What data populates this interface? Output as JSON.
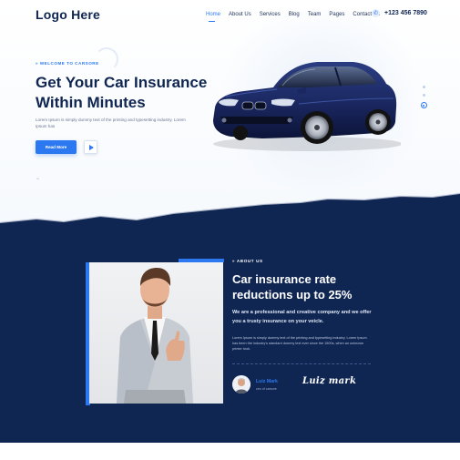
{
  "header": {
    "logo": "Logo Here",
    "nav": [
      "Home",
      "About Us",
      "Services",
      "Blog",
      "Team",
      "Pages",
      "Contact Us"
    ],
    "active_nav": "Home",
    "phone": "+123 456 7890",
    "phone_icon": "phone-icon"
  },
  "hero": {
    "eyebrow": "WELCOME TO CARSORE",
    "title": "Get Your Car Insurance Within Minutes",
    "description": "Lorem Ipsum is simply dummy text of the printing and typesetting industry. Lorem Ipsum has",
    "read_more": "Read More",
    "play_icon": "play-icon",
    "scroll_icon": "chevron-down-icon",
    "slider_dots": 3,
    "active_dot": 3
  },
  "about": {
    "tag": "ABOUT US",
    "title": "Car insurance rate reductions up to 25%",
    "lead": "We are a professional and creative company and we offer you a trusty insurance on your veicle.",
    "description": "Lorem Ipsum is simply dummy text of the printing and typesetting industry. Lorem Ipsum has been the industry's standard dummy text ever since the 1500s, when an unknown printer took.",
    "author_name": "Luiz Mark",
    "author_role": "ceo of carsore",
    "signature": "Luiz mark"
  },
  "colors": {
    "accent": "#2b78f0",
    "navy": "#0f2552",
    "white": "#ffffff"
  }
}
